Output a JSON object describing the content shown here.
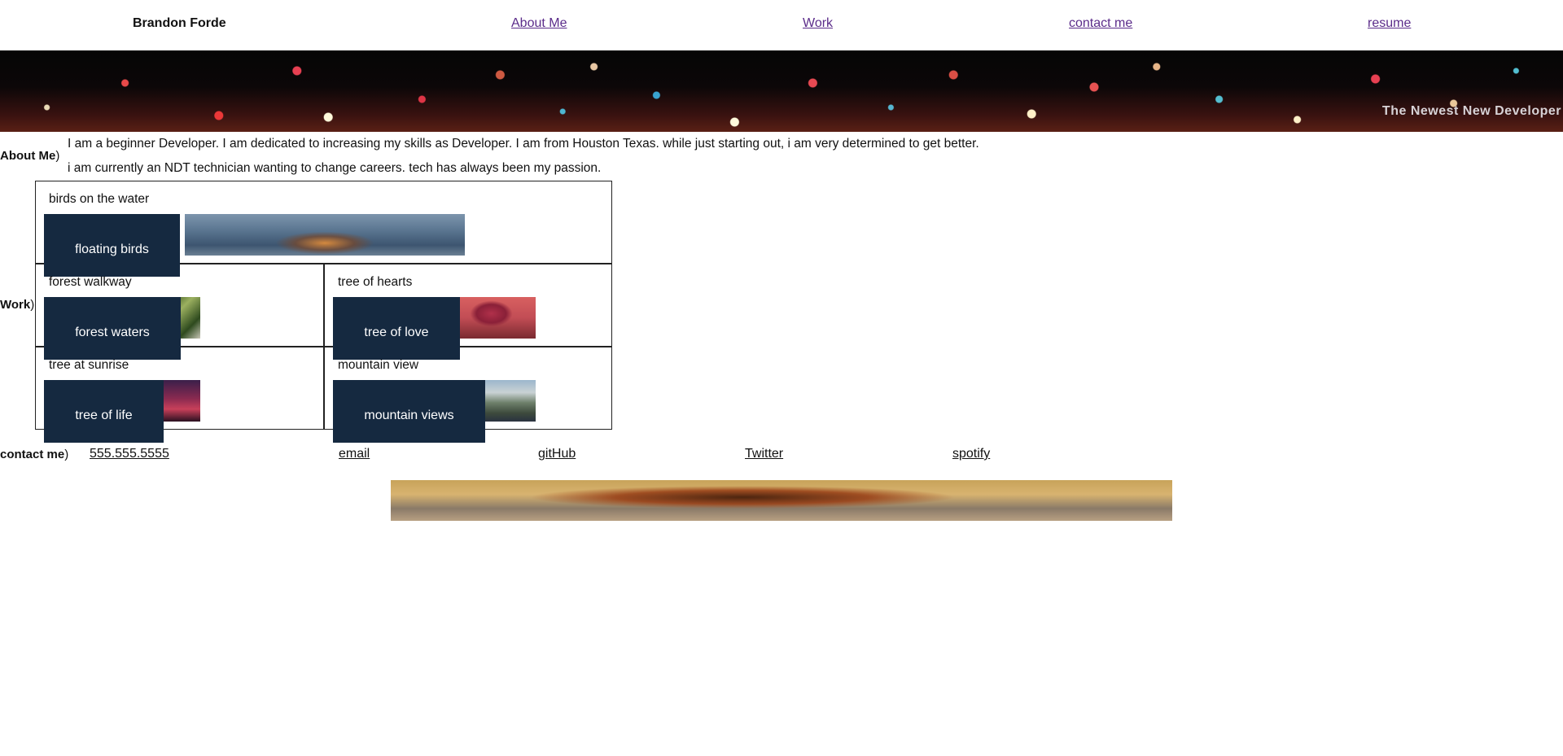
{
  "header": {
    "brand": "Brandon Forde",
    "nav": [
      {
        "label": "About Me"
      },
      {
        "label": "Work"
      },
      {
        "label": "contact me"
      },
      {
        "label": "resume"
      }
    ]
  },
  "hero": {
    "tagline": "The Newest New Developer"
  },
  "about": {
    "label": "About Me",
    "paragraphs": [
      "I am a beginner Developer. I am dedicated to increasing my skills as Developer. I am from Houston Texas. while just starting out, i am very determined to get better.",
      "i am currently an NDT technician wanting to change careers. tech has always been my passion."
    ]
  },
  "work": {
    "label": "Work",
    "items": [
      {
        "title": "birds on the water",
        "button": "floating birds"
      },
      {
        "title": "forest walkway",
        "button": "forest waters"
      },
      {
        "title": "tree of hearts",
        "button": "tree of love"
      },
      {
        "title": "tree at sunrise",
        "button": "tree of life"
      },
      {
        "title": "mountain view",
        "button": "mountain views"
      }
    ]
  },
  "contact": {
    "label": "contact me",
    "links": [
      {
        "label": "555.555.5555"
      },
      {
        "label": "email"
      },
      {
        "label": "gitHub"
      },
      {
        "label": "Twitter"
      },
      {
        "label": "spotify"
      }
    ]
  },
  "colors": {
    "button_bg": "#152940",
    "nav_link": "#5b2c8a",
    "border": "#222222"
  }
}
